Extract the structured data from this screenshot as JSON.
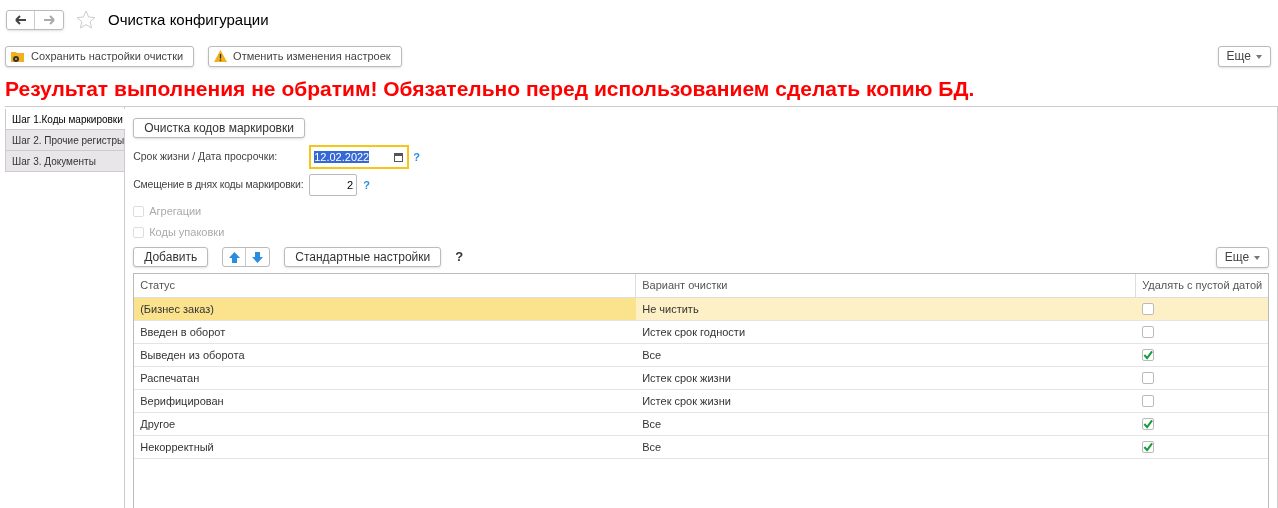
{
  "window": {
    "title": "Очистка конфигурации",
    "favorite": false
  },
  "toolbar": {
    "buttons": [
      {
        "label": "Сохранить настройки очистки",
        "kind": "save"
      },
      {
        "label": "Отменить изменения настроек",
        "kind": "warning"
      }
    ],
    "more": "Еще"
  },
  "warning": "Результат выполнения не обратим! Обязательно перед использованием сделать копию БД.",
  "steps": [
    {
      "label": "Шаг 1.Коды маркировки",
      "selected": true
    },
    {
      "label": "Шаг 2. Прочие регистры",
      "selected": false
    },
    {
      "label": "Шаг 3. Документы",
      "selected": false
    }
  ],
  "form": {
    "run_button": "Очистка кодов маркировки",
    "date_field": {
      "label": "Срок жизни / Дата просрочки:",
      "value": "12.02.2022",
      "help": "?"
    },
    "offset_field": {
      "label": "Смещение в днях коды маркировки:",
      "value": "2",
      "help": "?"
    },
    "checkboxes": [
      {
        "label": "Агрегации",
        "checked": false,
        "disabled": true
      },
      {
        "label": "Коды упаковки",
        "checked": false,
        "disabled": true
      }
    ],
    "table_toolbar": {
      "add": "Добавить",
      "defaults": "Стандартные настройки",
      "help": "?",
      "more": "Еще"
    }
  },
  "table": {
    "columns": [
      "Статус",
      "Вариант очистки",
      "Удалять с пустой датой"
    ],
    "rows": [
      {
        "status": "(Бизнес заказ)",
        "variant": "Не чистить",
        "delete_empty": false,
        "selected": true
      },
      {
        "status": "Введен в оборот",
        "variant": "Истек срок годности",
        "delete_empty": false,
        "selected": false
      },
      {
        "status": "Выведен из оборота",
        "variant": "Все",
        "delete_empty": true,
        "selected": false
      },
      {
        "status": "Распечатан",
        "variant": "Истек срок жизни",
        "delete_empty": false,
        "selected": false
      },
      {
        "status": "Верифицирован",
        "variant": "Истек срок жизни",
        "delete_empty": false,
        "selected": false
      },
      {
        "status": "Другое",
        "variant": "Все",
        "delete_empty": true,
        "selected": false
      },
      {
        "status": "Некорректный",
        "variant": "Все",
        "delete_empty": true,
        "selected": false
      }
    ]
  }
}
